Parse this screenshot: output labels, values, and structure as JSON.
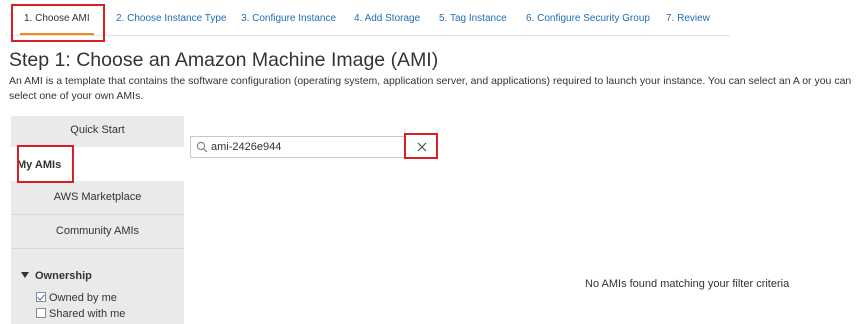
{
  "wizard": {
    "steps": [
      {
        "label": "1. Choose AMI"
      },
      {
        "label": "2. Choose Instance Type"
      },
      {
        "label": "3. Configure Instance"
      },
      {
        "label": "4. Add Storage"
      },
      {
        "label": "5. Tag Instance"
      },
      {
        "label": "6. Configure Security Group"
      },
      {
        "label": "7. Review"
      }
    ],
    "active_step": 0
  },
  "page": {
    "title": "Step 1: Choose an Amazon Machine Image (AMI)",
    "description": "An AMI is a template that contains the software configuration (operating system, application server, and applications) required to launch your instance. You can select an A or you can select one of your own AMIs."
  },
  "sidebar": {
    "items": [
      {
        "label": "Quick Start"
      },
      {
        "label": "My AMIs"
      },
      {
        "label": "AWS Marketplace"
      },
      {
        "label": "Community AMIs"
      }
    ],
    "selected": "My AMIs",
    "filter": {
      "heading": "Ownership",
      "options": [
        {
          "label": "Owned by me",
          "checked": true
        },
        {
          "label": "Shared with me",
          "checked": false
        }
      ]
    }
  },
  "search": {
    "value": "ami-2426e944",
    "icon": "search-icon",
    "clear_icon": "close-icon"
  },
  "results": {
    "empty_message": "No AMIs found matching your filter criteria"
  },
  "colors": {
    "link": "#1f6eb5",
    "active_underline": "#e98e1a",
    "highlight": "#d81f26",
    "sidebar_bg": "#eaeaea"
  }
}
